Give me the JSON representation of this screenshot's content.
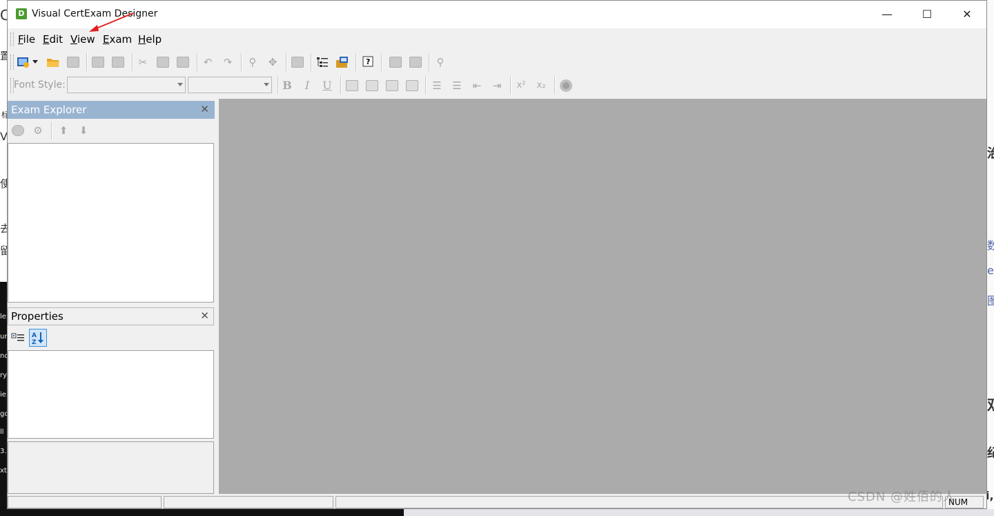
{
  "window": {
    "title": "Visual CertExam Designer",
    "icon_letter": "D",
    "controls": {
      "minimize": "—",
      "maximize": "☐",
      "close": "✕"
    }
  },
  "menu": {
    "items": [
      {
        "label": "File"
      },
      {
        "label": "Edit"
      },
      {
        "label": "View"
      },
      {
        "label": "Exam"
      },
      {
        "label": "Help"
      }
    ]
  },
  "toolbar2": {
    "font_style_label": "Font Style:",
    "bold": "B",
    "italic": "I",
    "underline": "U",
    "superscript": "x²",
    "subscript": "x₂"
  },
  "exam_explorer": {
    "title": "Exam Explorer",
    "close": "✕"
  },
  "properties": {
    "title": "Properties",
    "close": "✕"
  },
  "statusbar": {
    "num": "NUM"
  },
  "background": {
    "watermark": "CSDN @姓佰的人",
    "fragments_left": [
      "C",
      "置",
      "标",
      "Vi",
      "使",
      "去",
      "留"
    ],
    "fragments_right": [
      "治",
      "数",
      "e",
      "图",
      "双",
      "纪",
      "i,"
    ],
    "fragments_dark": [
      "le",
      "ur",
      "nd",
      "ry",
      "ie",
      "go",
      "ll",
      "3.",
      "xt"
    ]
  },
  "colors": {
    "panel_header_active": "#99b4d1",
    "workspace": "#ababab",
    "chrome": "#f0f0f0"
  }
}
